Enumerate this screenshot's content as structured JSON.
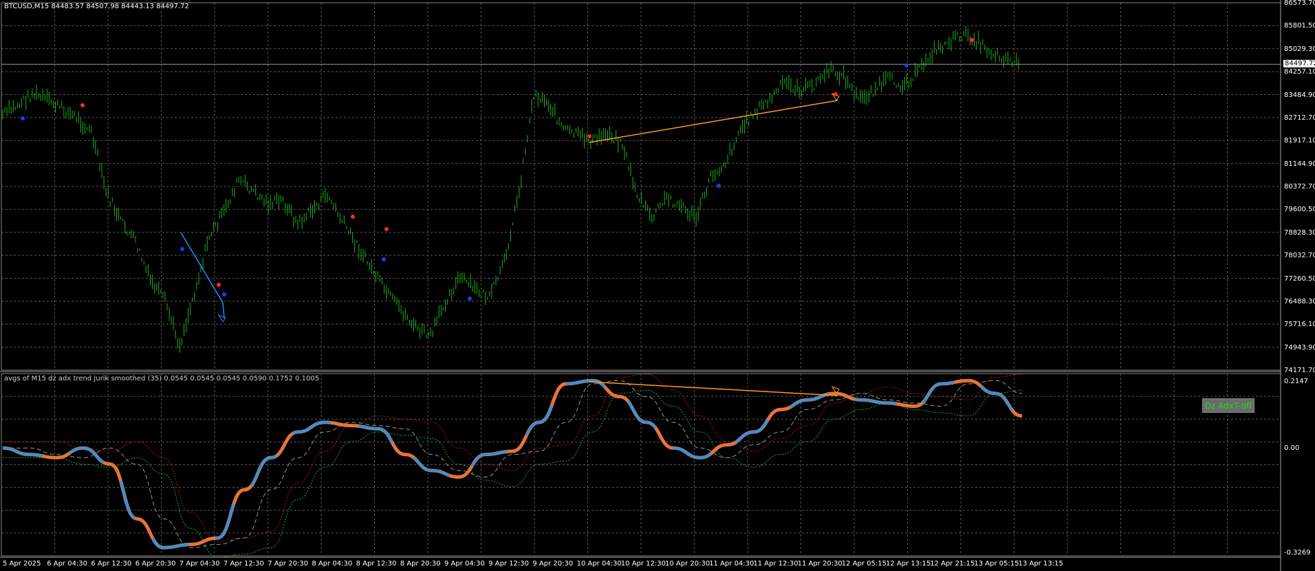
{
  "main_pane": {
    "title": "BTCUSD,M15  84483.57 84507.98 84443.13 84497.72",
    "current_price": "84497.72",
    "y_axis": [
      "86573.70",
      "85801.50",
      "85029.30",
      "84257.10",
      "83484.90",
      "82712.70",
      "81917.10",
      "81144.90",
      "80372.70",
      "79600.50",
      "78828.30",
      "78032.70",
      "77260.50",
      "76488.30",
      "75716.10",
      "74943.90",
      "74171.70"
    ]
  },
  "indicator_pane": {
    "title": "avgs of M15 dz adx trend Jurik smoothed (35) 0.0545 0.0545 0.0545 0.0590 0.1752 0.1005",
    "y_axis": [
      "0.2147",
      "0.00",
      "-0.3269"
    ],
    "button_label": "Dz AdxT-off"
  },
  "x_axis": [
    "5 Apr 2025",
    "6 Apr 04:30",
    "6 Apr 12:30",
    "6 Apr 20:30",
    "7 Apr 04:30",
    "7 Apr 12:30",
    "7 Apr 20:30",
    "8 Apr 04:30",
    "8 Apr 12:30",
    "8 Apr 20:30",
    "9 Apr 04:30",
    "9 Apr 12:30",
    "9 Apr 20:30",
    "10 Apr 04:30",
    "10 Apr 12:30",
    "10 Apr 20:30",
    "11 Apr 04:30",
    "11 Apr 12:30",
    "11 Apr 20:30",
    "12 Apr 05:15",
    "12 Apr 13:15",
    "12 Apr 21:15",
    "13 Apr 05:15",
    "13 Apr 13:15"
  ],
  "colors": {
    "background": "#000000",
    "grid": "#5a5a5a",
    "bars": "#1db31d",
    "trendline_blue": "#1e90ff",
    "trendline_orange": "#ff9a1f",
    "indicator_main_blue": "#3a8fd8",
    "indicator_main_orange": "#e8733a",
    "signal_red": "#ff2a2a",
    "signal_blue": "#1a3cff"
  },
  "chart_data": {
    "type": "line",
    "series": [
      {
        "values": [
          82800,
          83100,
          83500,
          83300,
          83000,
          82700,
          82200,
          80200,
          79200,
          78500,
          77200,
          76500,
          75000,
          76800,
          78700,
          79500,
          80600,
          80200,
          79800,
          79900,
          79100,
          79600,
          80100,
          79200,
          78400,
          77600,
          76800,
          76200,
          75600,
          75300,
          76500,
          77300,
          76900,
          76600,
          77800,
          80200,
          83500,
          83200,
          82300,
          82100,
          81900,
          82200,
          81800,
          80100,
          79300,
          80000,
          79700,
          79300,
          80700,
          81200,
          82300,
          82900,
          83300,
          83900,
          83600,
          83800,
          84300,
          84100,
          83300,
          83600,
          84000,
          83800,
          84200,
          84900,
          85200,
          85500,
          85300,
          84900,
          84700,
          84500
        ],
        "ylim": [
          74171.7,
          86573.7
        ]
      },
      {
        "values": [
          0.0,
          -0.02,
          -0.03,
          0.0,
          -0.05,
          -0.22,
          -0.31,
          -0.3,
          -0.28,
          -0.13,
          -0.03,
          0.05,
          0.08,
          0.07,
          0.06,
          -0.02,
          -0.07,
          -0.09,
          -0.02,
          -0.01,
          0.08,
          0.2,
          0.21,
          0.16,
          0.08,
          0.0,
          -0.03,
          0.01,
          0.05,
          0.12,
          0.15,
          0.17,
          0.15,
          0.14,
          0.13,
          0.2,
          0.21,
          0.17,
          0.1
        ],
        "ylim": [
          -0.3269,
          0.2147
        ]
      }
    ]
  }
}
